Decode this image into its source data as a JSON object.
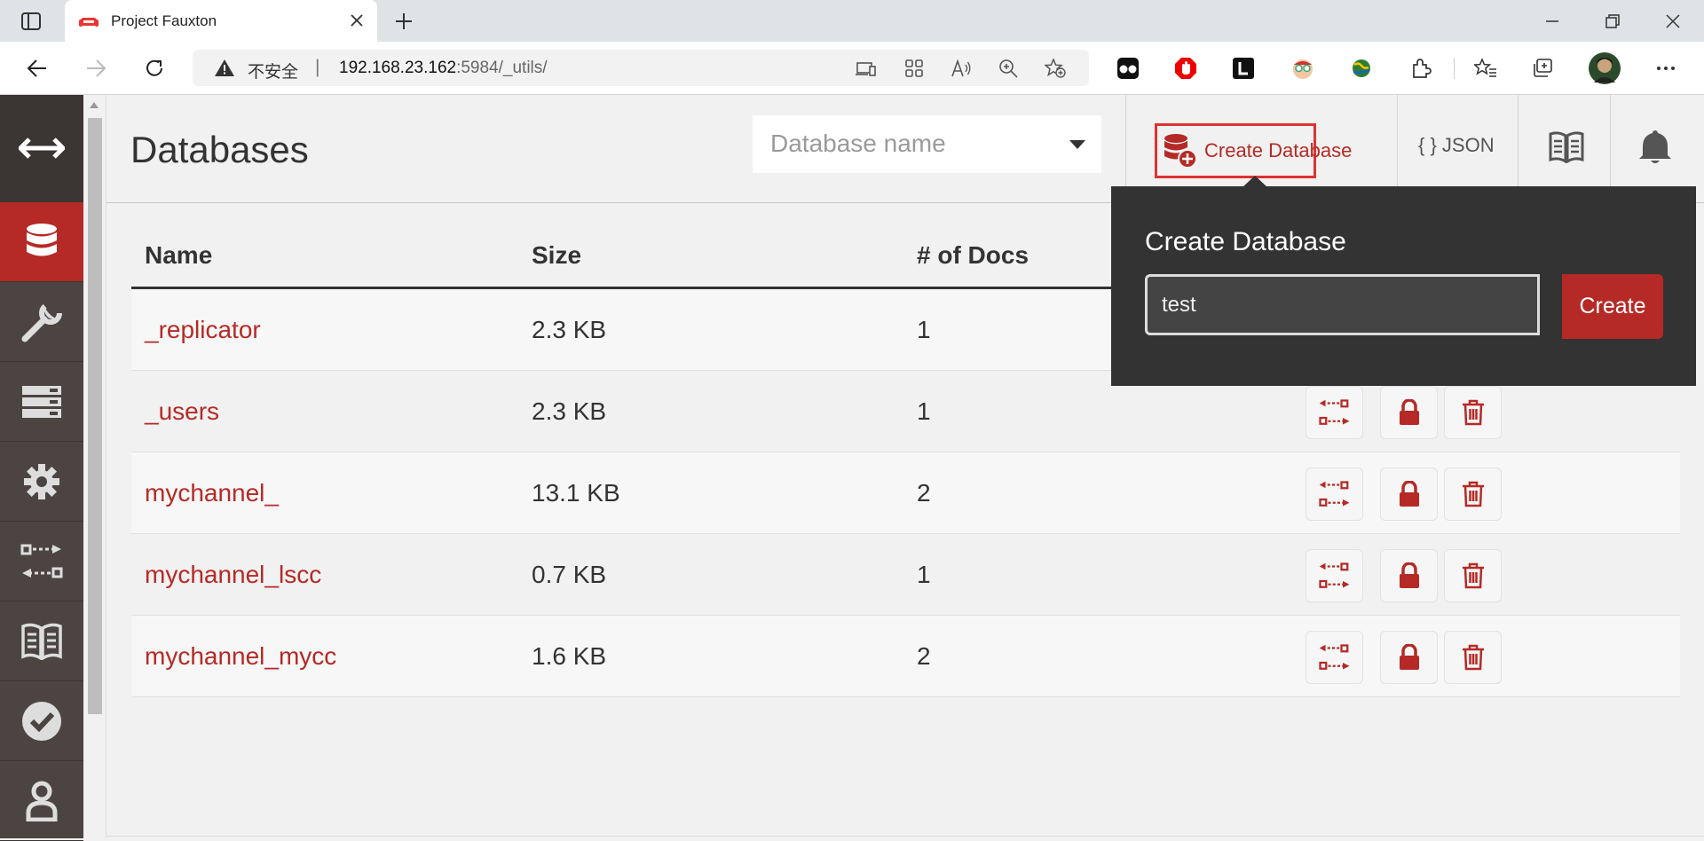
{
  "browser": {
    "tab_title": "Project Fauxton",
    "address_insecure_label": "不安全",
    "address_separator": "|",
    "address_host": "192.168.23.162",
    "address_path": ":5984/_utils/"
  },
  "header": {
    "title": "Databases",
    "db_search_placeholder": "Database name",
    "create_database_label": "Create Database",
    "json_label": "{ } JSON"
  },
  "table": {
    "columns": [
      "Name",
      "Size",
      "# of Docs"
    ],
    "rows": [
      {
        "name": "_replicator",
        "size": "2.3 KB",
        "docs": "1"
      },
      {
        "name": "_users",
        "size": "2.3 KB",
        "docs": "1"
      },
      {
        "name": "mychannel_",
        "size": "13.1 KB",
        "docs": "2"
      },
      {
        "name": "mychannel_lscc",
        "size": "0.7 KB",
        "docs": "1"
      },
      {
        "name": "mychannel_mycc",
        "size": "1.6 KB",
        "docs": "2"
      }
    ]
  },
  "popover": {
    "title": "Create Database",
    "input_value": "test",
    "create_label": "Create"
  },
  "colors": {
    "accent": "#b52a26",
    "sidebar": "#4b4442",
    "popover_bg": "#333333"
  },
  "icons": {
    "sidebar": [
      "collapse-arrows-icon",
      "database-icon",
      "wrench-icon",
      "server-icon",
      "gear-icon",
      "replication-icon",
      "documentation-book-icon",
      "verify-check-icon",
      "user-icon"
    ],
    "row_actions": [
      "replicate-icon",
      "lock-icon",
      "trash-icon"
    ]
  }
}
